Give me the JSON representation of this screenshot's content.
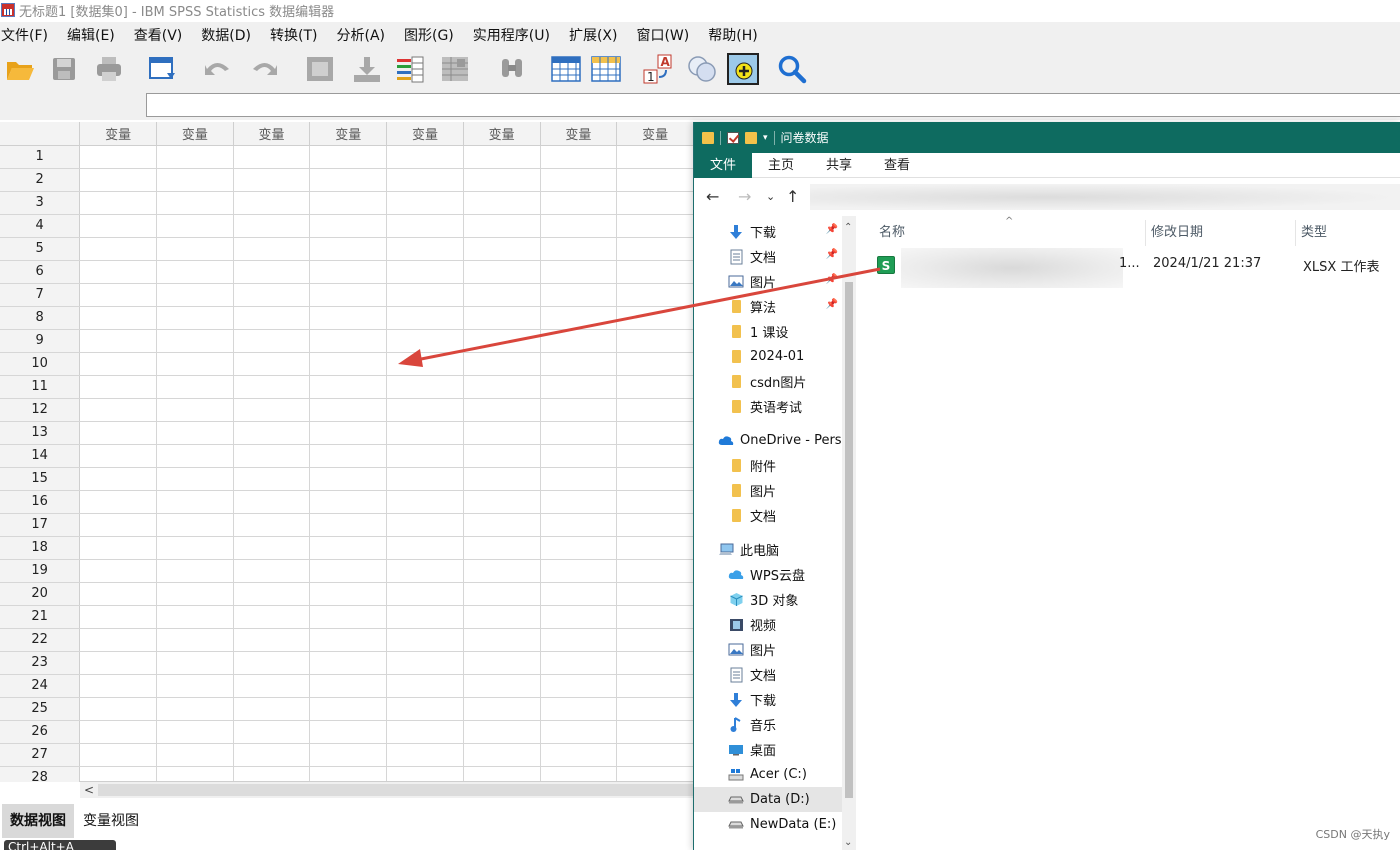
{
  "spss": {
    "window_title": "无标题1 [数据集0] - IBM SPSS Statistics 数据编辑器",
    "menu": [
      "文件(F)",
      "编辑(E)",
      "查看(V)",
      "数据(D)",
      "转换(T)",
      "分析(A)",
      "图形(G)",
      "实用程序(U)",
      "扩展(X)",
      "窗口(W)",
      "帮助(H)"
    ],
    "cell_editor_value": "",
    "column_header": "变量",
    "column_count": 8,
    "rows": [
      "1",
      "2",
      "3",
      "4",
      "5",
      "6",
      "7",
      "8",
      "9",
      "10",
      "11",
      "12",
      "13",
      "14",
      "15",
      "16",
      "17",
      "18",
      "19",
      "20",
      "21",
      "22",
      "23",
      "24",
      "25",
      "26",
      "27",
      "28"
    ],
    "tabs": [
      {
        "label": "数据视图",
        "active": true
      },
      {
        "label": "变量视图",
        "active": false
      }
    ],
    "status_snippet": "Ctrl+Alt+A"
  },
  "explorer": {
    "title": "问卷数据",
    "ribbon_tabs": [
      {
        "label": "文件",
        "active": true
      },
      {
        "label": "主页",
        "active": false
      },
      {
        "label": "共享",
        "active": false
      },
      {
        "label": "查看",
        "active": false
      }
    ],
    "tree": [
      {
        "label": "下载",
        "icon": "download-icon",
        "pinned": true
      },
      {
        "label": "文档",
        "icon": "document-icon",
        "pinned": true
      },
      {
        "label": "图片",
        "icon": "picture-icon",
        "pinned": true
      },
      {
        "label": "算法",
        "icon": "folder-icon",
        "pinned": true
      },
      {
        "label": "1 课设",
        "icon": "folder-icon",
        "pinned": false
      },
      {
        "label": "2024-01",
        "icon": "folder-icon",
        "pinned": false
      },
      {
        "label": "csdn图片",
        "icon": "folder-icon",
        "pinned": false
      },
      {
        "label": "英语考试",
        "icon": "folder-icon",
        "pinned": false
      },
      {
        "label": "OneDrive - Persc",
        "icon": "onedrive-icon",
        "pinned": false,
        "group": true
      },
      {
        "label": "附件",
        "icon": "folder-icon",
        "pinned": false
      },
      {
        "label": "图片",
        "icon": "folder-icon",
        "pinned": false
      },
      {
        "label": "文档",
        "icon": "folder-icon",
        "pinned": false
      },
      {
        "label": "此电脑",
        "icon": "computer-icon",
        "pinned": false,
        "group": true
      },
      {
        "label": "WPS云盘",
        "icon": "cloud-icon",
        "pinned": false
      },
      {
        "label": "3D 对象",
        "icon": "cube-icon",
        "pinned": false
      },
      {
        "label": "视频",
        "icon": "video-icon",
        "pinned": false
      },
      {
        "label": "图片",
        "icon": "picture-icon",
        "pinned": false
      },
      {
        "label": "文档",
        "icon": "document-icon",
        "pinned": false
      },
      {
        "label": "下载",
        "icon": "download-icon",
        "pinned": false
      },
      {
        "label": "音乐",
        "icon": "music-icon",
        "pinned": false
      },
      {
        "label": "桌面",
        "icon": "desktop-icon",
        "pinned": false
      },
      {
        "label": "Acer (C:)",
        "icon": "drive-c-icon",
        "pinned": false
      },
      {
        "label": "Data (D:)",
        "icon": "drive-icon",
        "pinned": false,
        "selected": true
      },
      {
        "label": "NewData (E:)",
        "icon": "drive-icon",
        "pinned": false
      }
    ],
    "columns": {
      "name": "名称",
      "date": "修改日期",
      "type": "类型"
    },
    "file": {
      "icon_letter": "S",
      "name_suffix": "1...",
      "date": "2024/1/21 21:37",
      "type": "XLSX 工作表"
    }
  },
  "watermark": "CSDN @天执y",
  "colors": {
    "explorer_accent": "#0e6b60",
    "arrow": "#d9463c"
  }
}
